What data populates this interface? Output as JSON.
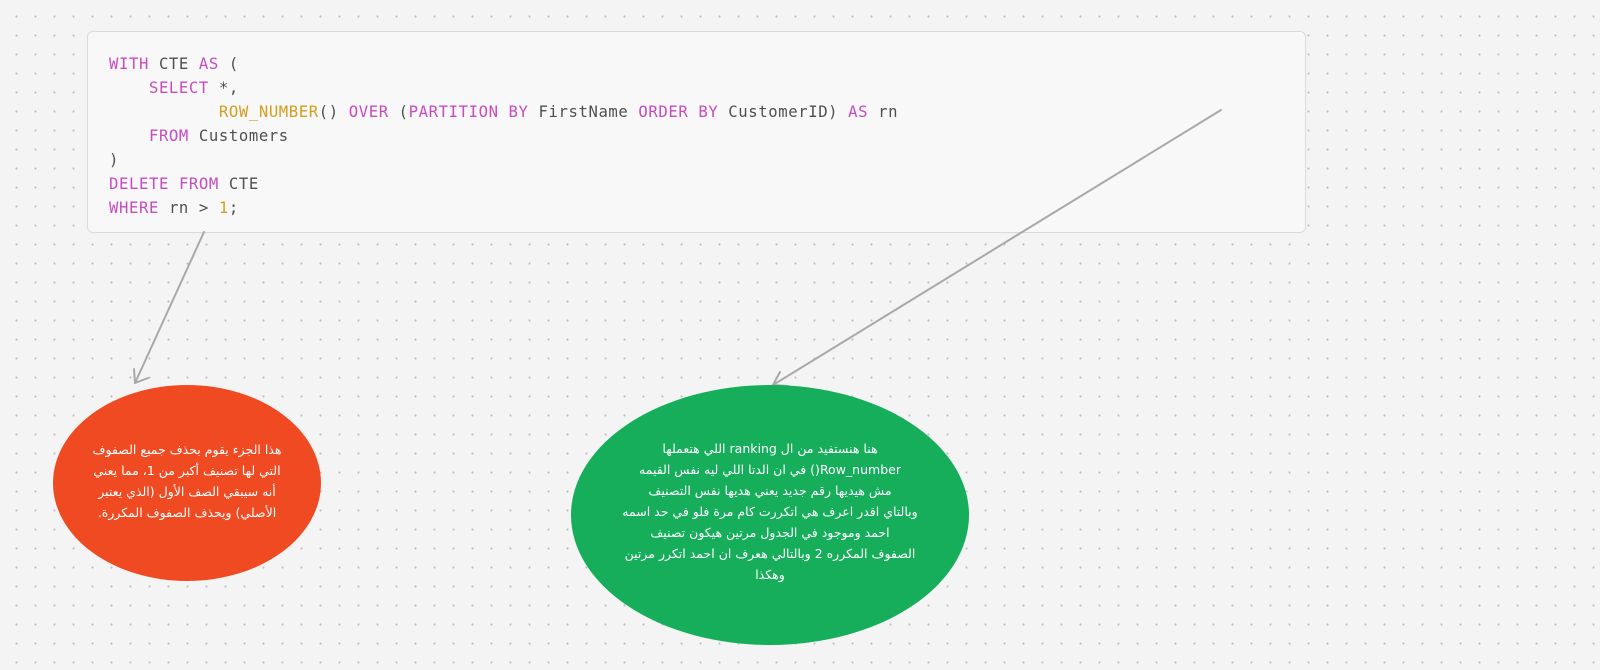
{
  "canvas": {
    "background": "#f4f4f4",
    "dot_color": "#bdbdbd"
  },
  "code_card": {
    "language": "sql",
    "lines": [
      [
        {
          "t": "WITH",
          "c": "kw"
        },
        {
          "t": " CTE ",
          "c": "plain"
        },
        {
          "t": "AS",
          "c": "kw"
        },
        {
          "t": " (",
          "c": "plain"
        }
      ],
      [
        {
          "t": "    ",
          "c": "plain"
        },
        {
          "t": "SELECT",
          "c": "kw"
        },
        {
          "t": " *,",
          "c": "plain"
        }
      ],
      [
        {
          "t": "           ",
          "c": "plain"
        },
        {
          "t": "ROW_NUMBER",
          "c": "fn"
        },
        {
          "t": "() ",
          "c": "plain"
        },
        {
          "t": "OVER",
          "c": "kw"
        },
        {
          "t": " (",
          "c": "plain"
        },
        {
          "t": "PARTITION BY",
          "c": "kw"
        },
        {
          "t": " FirstName ",
          "c": "plain"
        },
        {
          "t": "ORDER BY",
          "c": "kw"
        },
        {
          "t": " CustomerID) ",
          "c": "plain"
        },
        {
          "t": "AS",
          "c": "kw"
        },
        {
          "t": " rn",
          "c": "plain"
        }
      ],
      [
        {
          "t": "    ",
          "c": "plain"
        },
        {
          "t": "FROM",
          "c": "kw"
        },
        {
          "t": " Customers",
          "c": "plain"
        }
      ],
      [
        {
          "t": ")",
          "c": "plain"
        }
      ],
      [
        {
          "t": "DELETE",
          "c": "kw"
        },
        {
          "t": " ",
          "c": "plain"
        },
        {
          "t": "FROM",
          "c": "kw"
        },
        {
          "t": " CTE",
          "c": "plain"
        }
      ],
      [
        {
          "t": "WHERE",
          "c": "kw"
        },
        {
          "t": " rn > ",
          "c": "plain"
        },
        {
          "t": "1",
          "c": "num"
        },
        {
          "t": ";",
          "c": "plain"
        }
      ]
    ],
    "colors": {
      "keyword": "#c74bbf",
      "function": "#d49d1e",
      "number": "#d49d1e",
      "text": "#505050"
    }
  },
  "notes": {
    "delete_note": {
      "color": "#f04a23",
      "lines": [
        "هذا الجزء يقوم بحذف جميع الصفوف",
        "التي لها تصنيف أكبر من 1، مما يعني",
        "أنه سيبقي الصف الأول (الذي يعتبر",
        "الأصلي) ويحذف الصفوف المكررة."
      ]
    },
    "ranking_note": {
      "color": "#16ad5b",
      "lines": [
        "هنا هنستفيد من ال ranking اللي هتعملها",
        "Row_number() في ان الدتا اللي ليه نفس القيمه",
        "مش هيديها رقم جديد يعني هديها نفس التصنيف",
        "وبالتاي اقدر اعرف هي اتكررت كام مرة فلو في حد اسمه",
        "احمد وموجود في الجدول مرتين هيكون تصنيف",
        "الصفوف المكرره 2 وبالتالي هعرف ان احمد اتكرر مرتين",
        "وهكذا"
      ]
    }
  },
  "connectors": {
    "color": "#a9a9a9",
    "items": [
      {
        "name": "arrow-delete-to-note",
        "from": "code_card.where_clause",
        "to": "notes.delete_note"
      },
      {
        "name": "arrow-rn-to-note",
        "from": "code_card.rn_alias",
        "to": "notes.ranking_note"
      }
    ]
  }
}
